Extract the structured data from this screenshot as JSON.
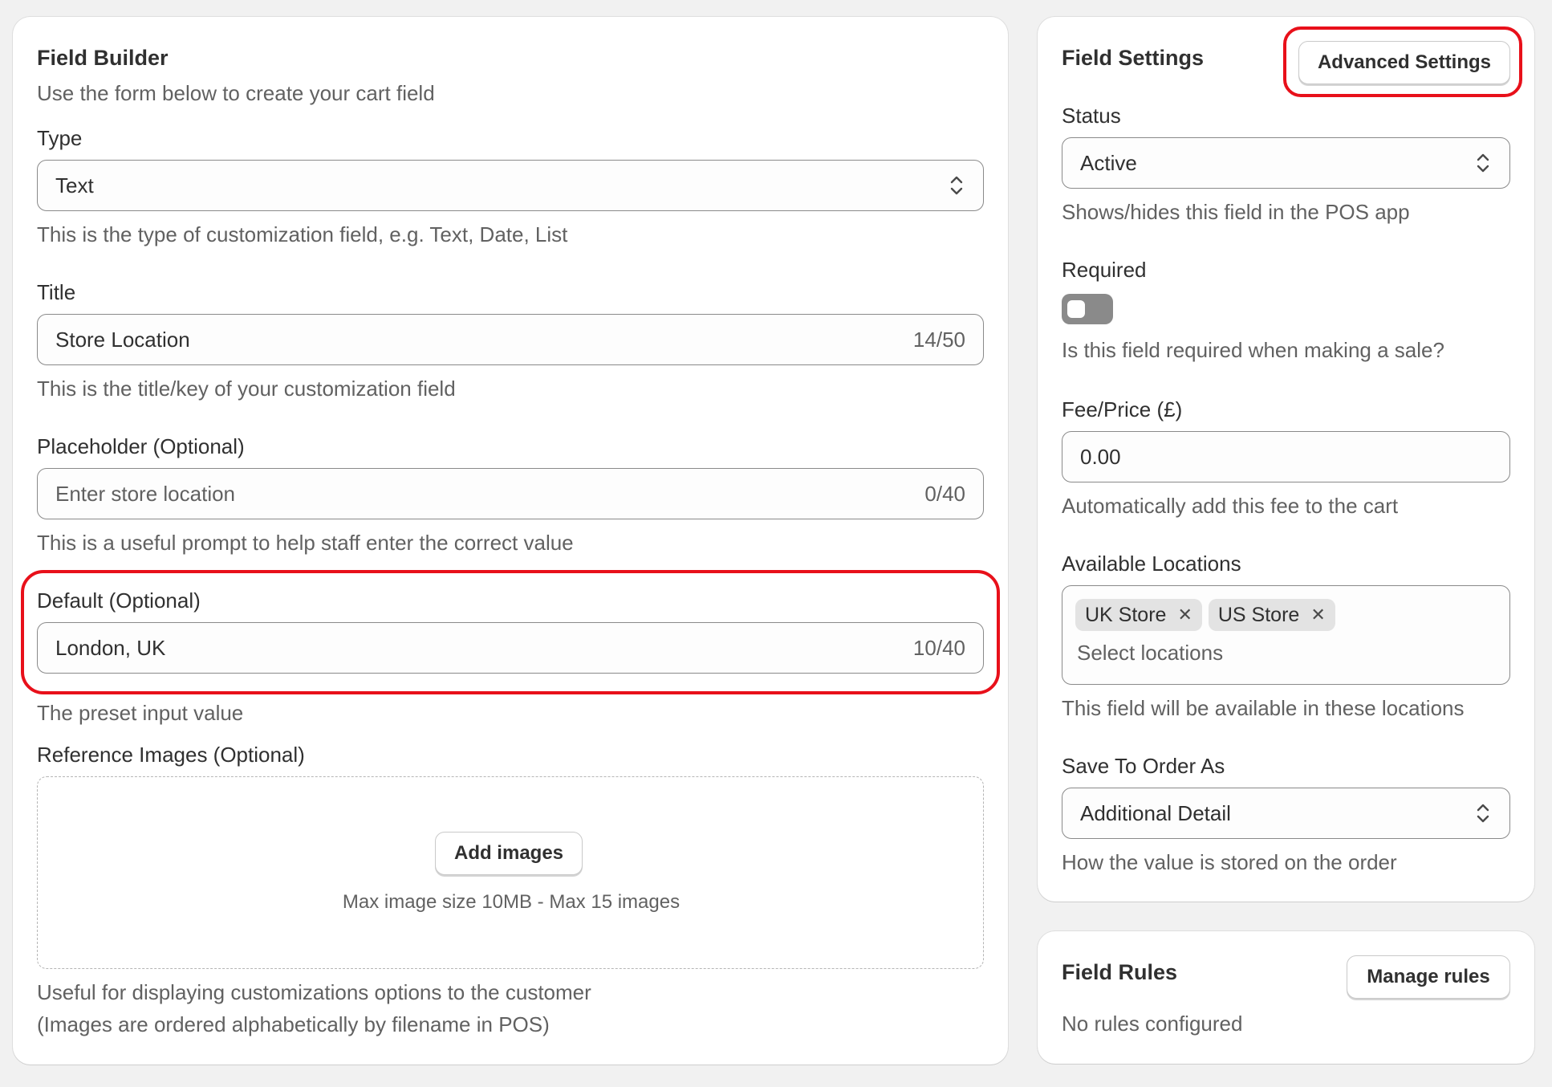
{
  "builder": {
    "title": "Field Builder",
    "subtitle": "Use the form below to create your cart field",
    "type": {
      "label": "Type",
      "value": "Text",
      "help": "This is the type of customization field, e.g. Text, Date, List"
    },
    "title_field": {
      "label": "Title",
      "value": "Store Location",
      "counter": "14/50",
      "help": "This is the title/key of your customization field"
    },
    "placeholder": {
      "label": "Placeholder (Optional)",
      "placeholder": "Enter store location",
      "counter": "0/40",
      "help": "This is a useful prompt to help staff enter the correct value"
    },
    "default": {
      "label": "Default (Optional)",
      "value": "London, UK",
      "counter": "10/40",
      "help": "The preset input value"
    },
    "images": {
      "label": "Reference Images (Optional)",
      "button": "Add images",
      "limits": "Max image size 10MB - Max 15 images",
      "help1": "Useful for displaying customizations options to the customer",
      "help2": "(Images are ordered alphabetically by filename in POS)"
    }
  },
  "settings": {
    "title": "Field Settings",
    "advanced_button": "Advanced Settings",
    "status": {
      "label": "Status",
      "value": "Active",
      "help": "Shows/hides this field in the POS app"
    },
    "required": {
      "label": "Required",
      "on": false,
      "help": "Is this field required when making a sale?"
    },
    "fee": {
      "label": "Fee/Price (£)",
      "value": "0.00",
      "help": "Automatically add this fee to the cart"
    },
    "locations": {
      "label": "Available Locations",
      "tags": [
        "UK Store",
        "US Store"
      ],
      "placeholder": "Select locations",
      "help": "This field will be available in these locations"
    },
    "save_as": {
      "label": "Save To Order As",
      "value": "Additional Detail",
      "help": "How the value is stored on the order"
    }
  },
  "rules": {
    "title": "Field Rules",
    "button": "Manage rules",
    "empty": "No rules configured"
  },
  "colors": {
    "highlight": "#e8101a",
    "toggle_off": "#8a8a8a"
  }
}
